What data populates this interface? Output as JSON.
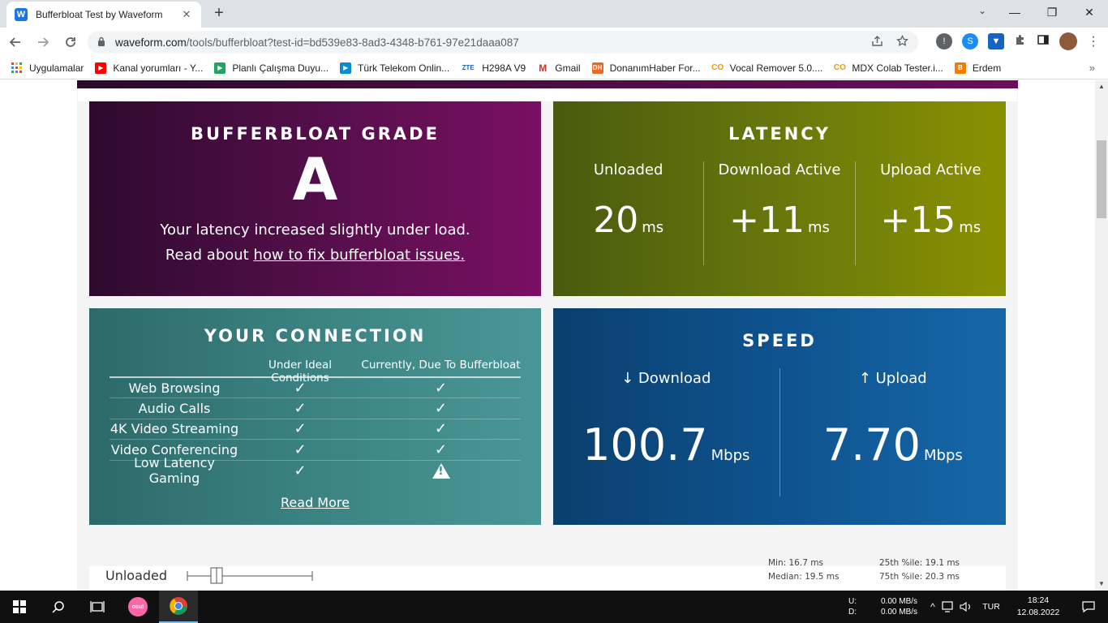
{
  "browser": {
    "tab_title": "Bufferbloat Test by Waveform",
    "tab_close": "✕",
    "new_tab": "+",
    "tab_dropdown": "⌄",
    "window": {
      "minimize": "—",
      "maximize": "❐",
      "close": "✕"
    },
    "url_host": "waveform.com",
    "url_path": "/tools/bufferbloat?test-id=bd539e83-8ad3-4348-b761-97e21daaa087",
    "bookmarks": [
      {
        "label": "Uygulamalar",
        "color": "#ea4335"
      },
      {
        "label": "Kanal yorumları - Y...",
        "color": "#ff0000"
      },
      {
        "label": "Planlı Çalışma Duyu...",
        "color": "#1fa463"
      },
      {
        "label": "Türk Telekom Onlin...",
        "color": "#0b8bd6"
      },
      {
        "label": "H298A V9",
        "color": "#1565c0"
      },
      {
        "label": "Gmail",
        "color": "#d93025"
      },
      {
        "label": "DonanımHaber For...",
        "color": "#e8672b"
      },
      {
        "label": "Vocal Remover 5.0....",
        "color": "#f29900"
      },
      {
        "label": "MDX Colab Tester.i...",
        "color": "#f29900"
      },
      {
        "label": "Erdem",
        "color": "#f57c00"
      }
    ],
    "bookmarks_more": "»"
  },
  "grade": {
    "title": "BUFFERBLOAT GRADE",
    "letter": "A",
    "summary": "Your latency increased slightly under load.",
    "read_prefix": "Read about ",
    "read_link": "how to fix bufferbloat issues."
  },
  "latency": {
    "title": "LATENCY",
    "columns": [
      {
        "label": "Unloaded",
        "value": "20",
        "unit": "ms"
      },
      {
        "label": "Download Active",
        "value": "+11",
        "unit": "ms"
      },
      {
        "label": "Upload Active",
        "value": "+15",
        "unit": "ms"
      }
    ]
  },
  "connection": {
    "title": "YOUR CONNECTION",
    "col_ideal": "Under Ideal Conditions",
    "col_current": "Currently, Due To Bufferbloat",
    "rows": [
      {
        "label": "Web Browsing",
        "ideal": "✓",
        "current": "✓"
      },
      {
        "label": "Audio Calls",
        "ideal": "✓",
        "current": "✓"
      },
      {
        "label": "4K Video Streaming",
        "ideal": "✓",
        "current": "✓"
      },
      {
        "label": "Video Conferencing",
        "ideal": "✓",
        "current": "✓"
      },
      {
        "label": "Low Latency Gaming",
        "ideal": "✓",
        "current": "warning"
      }
    ],
    "read_more": "Read More"
  },
  "speed": {
    "title": "SPEED",
    "download_label": "↓ Download",
    "download_value": "100.7",
    "download_unit": "Mbps",
    "upload_label": "↑ Upload",
    "upload_value": "7.70",
    "upload_unit": "Mbps"
  },
  "unloaded_detail": {
    "label": "Unloaded",
    "min": "Min: 16.7 ms",
    "median": "Median: 19.5 ms",
    "p25": "25th %ile: 19.1 ms",
    "p75": "75th %ile: 20.3 ms"
  },
  "taskbar": {
    "net_up_label": "U:",
    "net_down_label": "D:",
    "net_up": "0.00 MB/s",
    "net_down": "0.00 MB/s",
    "language": "TUR",
    "time": "18:24",
    "date": "12.08.2022",
    "osu_label": "osu!"
  }
}
